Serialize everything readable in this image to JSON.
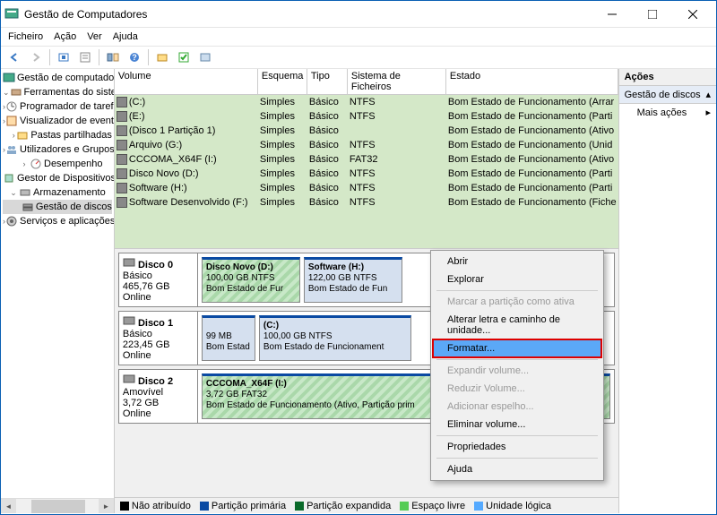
{
  "window": {
    "title": "Gestão de Computadores"
  },
  "menu": {
    "file": "Ficheiro",
    "action": "Ação",
    "view": "Ver",
    "help": "Ajuda"
  },
  "tree": {
    "root": "Gestão de computadores (loca",
    "sys_tools": "Ferramentas do sistema",
    "task_sched": "Programador de tarefas",
    "event_viewer": "Visualizador de eventos",
    "shared_folders": "Pastas partilhadas",
    "users_groups": "Utilizadores e Grupos Lo",
    "performance": "Desempenho",
    "device_mgr": "Gestor de Dispositivos",
    "storage": "Armazenamento",
    "disk_mgmt": "Gestão de discos",
    "services": "Serviços e aplicações"
  },
  "vol_head": {
    "volume": "Volume",
    "layout": "Esquema",
    "type": "Tipo",
    "fs": "Sistema de Ficheiros",
    "status": "Estado"
  },
  "volumes": [
    {
      "name": "(C:)",
      "layout": "Simples",
      "type": "Básico",
      "fs": "NTFS",
      "status": "Bom Estado de Funcionamento (Arrar"
    },
    {
      "name": "(E:)",
      "layout": "Simples",
      "type": "Básico",
      "fs": "NTFS",
      "status": "Bom Estado de Funcionamento (Parti"
    },
    {
      "name": "(Disco 1 Partição 1)",
      "layout": "Simples",
      "type": "Básico",
      "fs": "",
      "status": "Bom Estado de Funcionamento (Ativo"
    },
    {
      "name": "Arquivo (G:)",
      "layout": "Simples",
      "type": "Básico",
      "fs": "NTFS",
      "status": "Bom Estado de Funcionamento (Unid"
    },
    {
      "name": "CCCOMA_X64F (I:)",
      "layout": "Simples",
      "type": "Básico",
      "fs": "FAT32",
      "status": "Bom Estado de Funcionamento (Ativo"
    },
    {
      "name": "Disco Novo (D:)",
      "layout": "Simples",
      "type": "Básico",
      "fs": "NTFS",
      "status": "Bom Estado de Funcionamento (Parti"
    },
    {
      "name": "Software (H:)",
      "layout": "Simples",
      "type": "Básico",
      "fs": "NTFS",
      "status": "Bom Estado de Funcionamento (Parti"
    },
    {
      "name": "Software Desenvolvido (F:)",
      "layout": "Simples",
      "type": "Básico",
      "fs": "NTFS",
      "status": "Bom Estado de Funcionamento (Fiche"
    }
  ],
  "disks": {
    "d0": {
      "name": "Disco 0",
      "type": "Básico",
      "size": "465,76 GB",
      "status": "Online"
    },
    "d0_p1": {
      "title": "Disco Novo  (D:)",
      "line2": "100,00 GB NTFS",
      "line3": "Bom Estado de Fur"
    },
    "d0_p2": {
      "title": "Software  (H:)",
      "line2": "122,00 GB NTFS",
      "line3": "Bom Estado de Fun"
    },
    "d1": {
      "name": "Disco 1",
      "type": "Básico",
      "size": "223,45 GB",
      "status": "Online"
    },
    "d1_p1": {
      "title": "",
      "line2": "99 MB",
      "line3": "Bom Estad"
    },
    "d1_p2": {
      "title": "(C:)",
      "line2": "100,00 GB NTFS",
      "line3": "Bom Estado de Funcionament"
    },
    "d2": {
      "name": "Disco 2",
      "type": "Amovível",
      "size": "3,72 GB",
      "status": "Online"
    },
    "d2_p1": {
      "title": "CCCOMA_X64F  (I:)",
      "line2": "3,72 GB FAT32",
      "line3": "Bom Estado de Funcionamento (Ativo, Partição prim"
    }
  },
  "legend": {
    "unalloc": "Não atribuído",
    "primary": "Partição primária",
    "extended": "Partição expandida",
    "free": "Espaço livre",
    "logical": "Unidade lógica"
  },
  "actions": {
    "title": "Ações",
    "disk_mgmt": "Gestão de discos",
    "more": "Mais ações"
  },
  "ctx": {
    "open": "Abrir",
    "explore": "Explorar",
    "mark_active": "Marcar a partição como ativa",
    "change_letter": "Alterar letra e caminho de unidade...",
    "format": "Formatar...",
    "extend": "Expandir volume...",
    "shrink": "Reduzir Volume...",
    "mirror": "Adicionar espelho...",
    "delete": "Eliminar volume...",
    "properties": "Propriedades",
    "help": "Ajuda"
  }
}
